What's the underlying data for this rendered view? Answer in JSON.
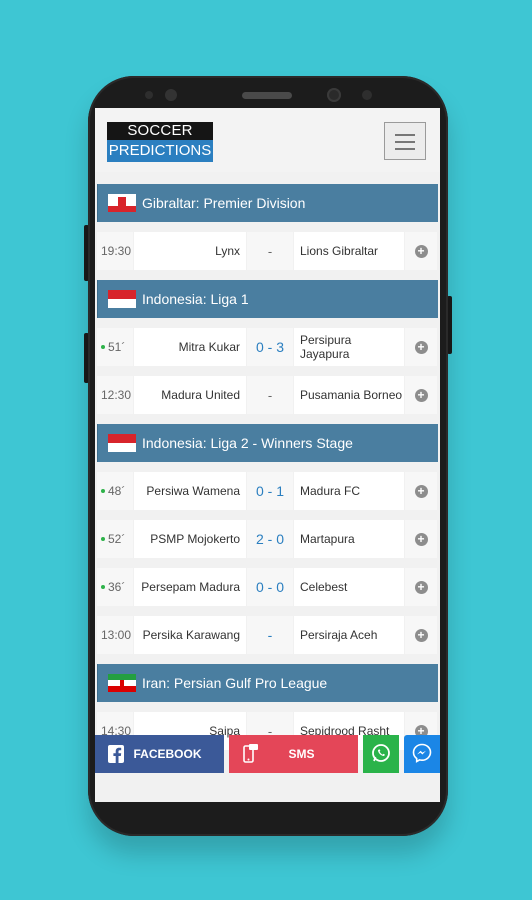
{
  "app": {
    "logo_top": "SOCCER",
    "logo_bottom": "PREDICTIONS",
    "menu_icon": "hamburger-icon"
  },
  "leagues": [
    {
      "name": "Gibraltar: Premier Division",
      "flag": "gibraltar-flag",
      "matches": [
        {
          "time": "19:30",
          "live": false,
          "home": "Lynx",
          "score": "-",
          "away": "Lions Gibraltar"
        }
      ]
    },
    {
      "name": "Indonesia: Liga 1",
      "flag": "indonesia-flag",
      "matches": [
        {
          "time": "51´",
          "live": true,
          "home": "Mitra Kukar",
          "score": "0 - 3",
          "away": "Persipura Jayapura"
        },
        {
          "time": "12:30",
          "live": false,
          "home": "Madura United",
          "score": "-",
          "away": "Pusamania Borneo"
        }
      ]
    },
    {
      "name": "Indonesia: Liga 2 - Winners Stage",
      "flag": "indonesia-flag",
      "matches": [
        {
          "time": "48´",
          "live": true,
          "home": "Persiwa Wamena",
          "score": "0 - 1",
          "away": "Madura FC"
        },
        {
          "time": "52´",
          "live": true,
          "home": "PSMP Mojokerto",
          "score": "2 - 0",
          "away": "Martapura"
        },
        {
          "time": "36´",
          "live": true,
          "home": "Persepam Madura",
          "score": "0 - 0",
          "away": "Celebest"
        },
        {
          "time": "13:00",
          "live": false,
          "home": "Persika Karawang",
          "score": "-",
          "away": "Persiraja Aceh"
        }
      ]
    },
    {
      "name": "Iran: Persian Gulf Pro League",
      "flag": "iran-flag",
      "matches": [
        {
          "time": "14:30",
          "live": false,
          "home": "Saipa",
          "score": "-",
          "away": "Sepidrood Rasht"
        }
      ]
    }
  ],
  "share": {
    "facebook": "FACEBOOK",
    "sms": "SMS",
    "whatsapp_icon": "whatsapp-icon",
    "messenger_icon": "messenger-icon"
  },
  "colors": {
    "background": "#3ec6d3",
    "league_bar": "#4a7ea0",
    "score": "#2b7fc0",
    "live": "#2eb24a",
    "facebook": "#3b5998",
    "sms": "#e44658",
    "whatsapp": "#2ab34a",
    "messenger": "#1b86e6"
  }
}
